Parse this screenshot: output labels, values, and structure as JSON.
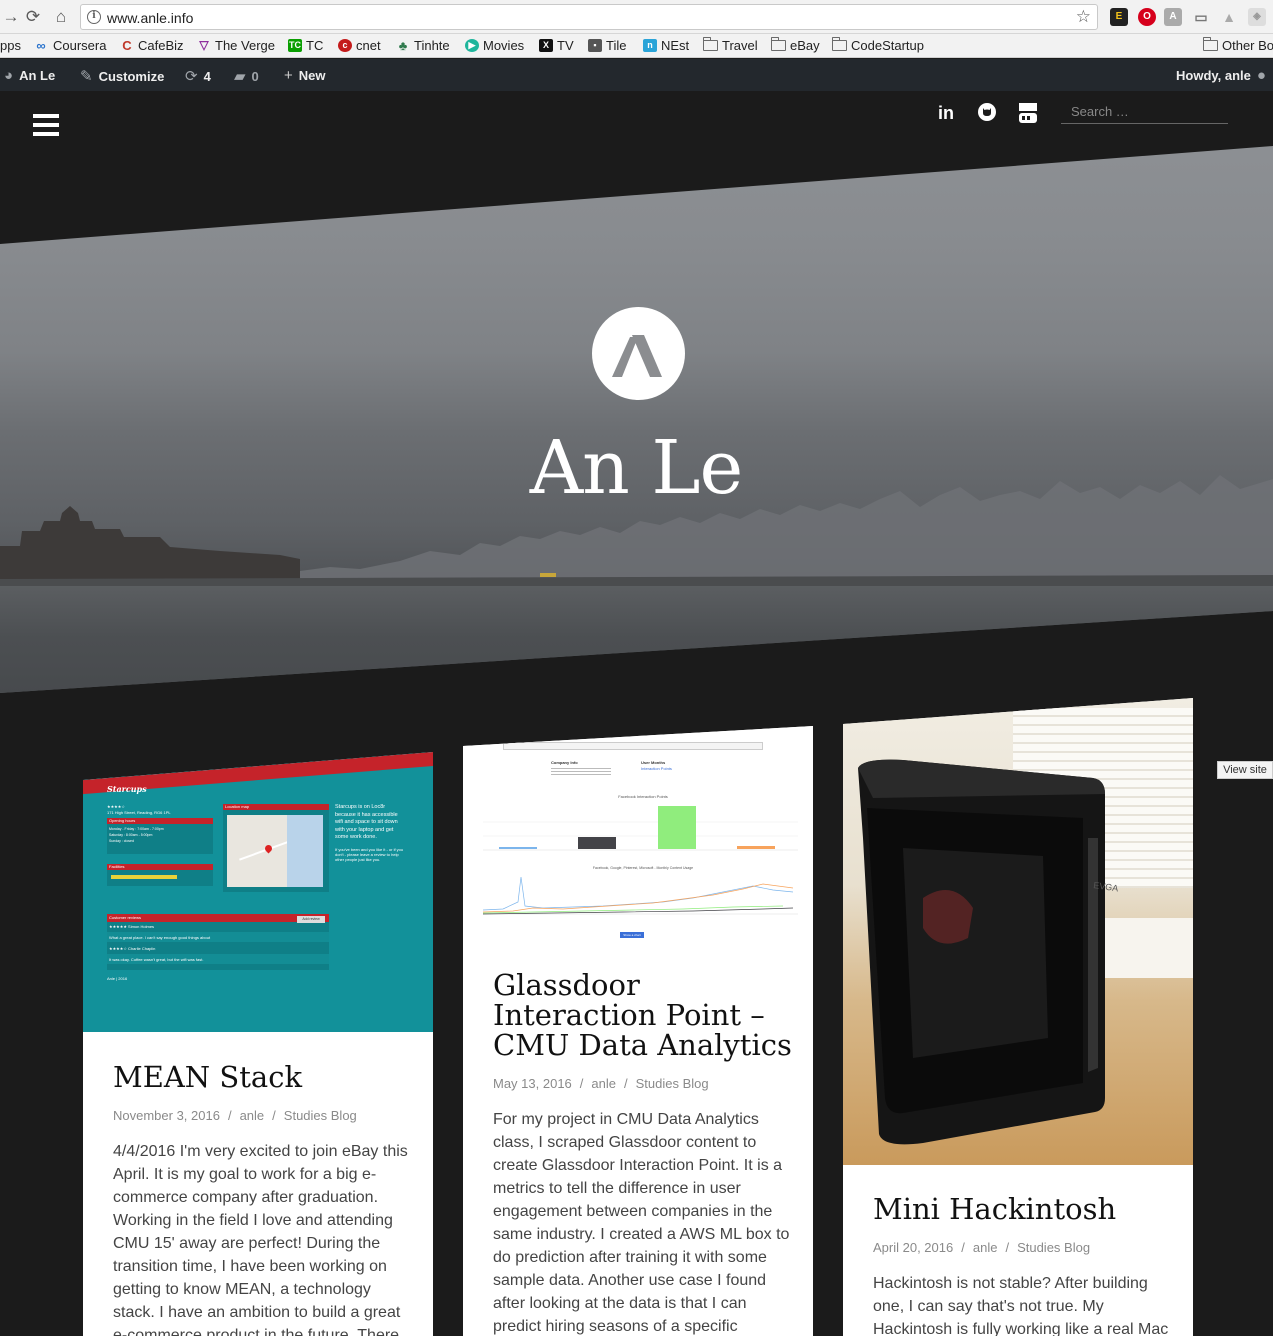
{
  "browser": {
    "url": "www.anle.info",
    "bookmarks": [
      "pps",
      "Coursera",
      "CafeBiz",
      "The Verge",
      "TC",
      "cnet",
      "Tinhte",
      "Movies",
      "TV",
      "Tile",
      "NEst",
      "Travel",
      "eBay",
      "CodeStartup",
      "Other Bo"
    ]
  },
  "adminbar": {
    "site_name": "An Le",
    "customize": "Customize",
    "updates_count": "4",
    "comments_count": "0",
    "new_label": "New",
    "howdy": "Howdy, anle"
  },
  "header": {
    "search_placeholder": "Search …",
    "site_title": "An Le",
    "social": [
      "linkedin-icon",
      "github-icon",
      "youtube-icon"
    ]
  },
  "posts": [
    {
      "title": "MEAN Stack",
      "date": "November 3, 2016",
      "author": "anle",
      "category": "Studies Blog",
      "excerpt": " 4/4/2016 I'm very excited to join eBay this April. It is my goal to work for a big e-commerce company after graduation. Working in the field I love and attending CMU 15' away are perfect! During the transition time, I have been working on getting to know MEAN, a technology stack. I have an ambition to build a great e-commerce product in the future. There"
    },
    {
      "title": "Glassdoor Interaction Point – CMU Data Analytics",
      "date": "May 13, 2016",
      "author": "anle",
      "category": "Studies Blog",
      "excerpt": "For my project in CMU Data Analytics class, I scraped Glassdoor content to create Glassdoor Interaction Point. It is a metrics to tell the difference in user engagement between companies in the same industry. I created a AWS ML box to do prediction after training it with some sample data. Another use case I found after looking at the data is that I can predict hiring seasons of  a specific"
    },
    {
      "title": "Mini Hackintosh",
      "date": "April 20, 2016",
      "author": "anle",
      "category": "Studies Blog",
      "excerpt": "Hackintosh is not stable? After building one, I can say that's not true. My Hackintosh is fully working like a real Mac"
    }
  ],
  "thumb1": {
    "brand": "Starcups",
    "address": "171 High Street, Reading, RG6 1PL",
    "opening_hours": "Opening hours",
    "hours": [
      "Monday - Friday : 7:00am - 7:00pm",
      "Saturday : 8:00am - 5:00pm",
      "Sunday : closed"
    ],
    "facilities": "Facilities",
    "location_map": "Location map",
    "sidebar_text": "Starcups is on Loc8r because it has accessible wifi and space to sit down with your laptop and get some work done.",
    "sidebar_text2": "If you've been and you like it - or if you don't - please leave a review to help other people just like you.",
    "reviews": "Customer reviews",
    "add_review": "Add review",
    "review1_author": "★★★★★ Simon Holmes",
    "review1": "What a great place. I can't say enough good things about",
    "review2_author": "★★★★☆ Charlie Chaplin",
    "review2": "It was okay. Coffee wasn't great, but the wifi was fast.",
    "footer": "Anle | 2016"
  },
  "thumb2": {
    "company_info": "Company Info",
    "user_months": "User Months",
    "chart_title": "Facebook Interaction Points",
    "chart2_title": "Facebook, Google, Pinterest, Microsoft - Monthly Content Usage",
    "bar_labels": [
      "Facebook",
      "Google",
      "Pinterest",
      "Microsoft"
    ],
    "button": "Show a chart"
  },
  "view_site": "View site",
  "colors": {
    "accent": "#c5232a",
    "teal": "#12919a",
    "adminbar": "#23282d",
    "page_bg": "#1b1b1b"
  }
}
